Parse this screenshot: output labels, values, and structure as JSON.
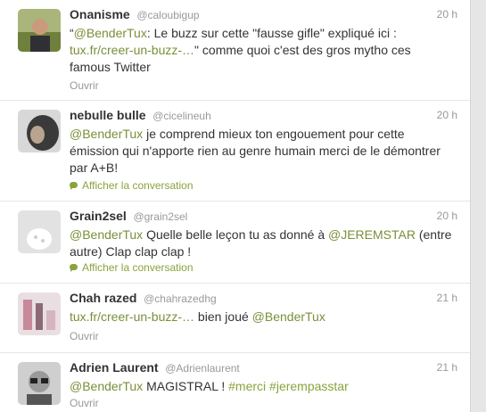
{
  "tweets": [
    {
      "name": "Onanisme",
      "handle": "@caloubigup",
      "time": "20 h",
      "text": [
        {
          "t": "“",
          "c": "plain"
        },
        {
          "t": "@BenderTux",
          "c": "link"
        },
        {
          "t": ": Le buzz sur cette \"fausse gifle\" expliqué ici : ",
          "c": "plain"
        },
        {
          "t": "tux.fr/creer-un-buzz-…",
          "c": "link"
        },
        {
          "t": "\" comme quoi c'est des gros mytho ces famous Twitter",
          "c": "plain"
        }
      ],
      "action": "Ouvrir"
    },
    {
      "name": "nebulle bulle",
      "handle": "@cicelineuh",
      "time": "20 h",
      "text": [
        {
          "t": "@BenderTux",
          "c": "link"
        },
        {
          "t": " je comprend mieux ton engouement pour cette émission qui n'apporte rien au genre humain merci de le démontrer par A+B!",
          "c": "plain"
        }
      ],
      "action": "Afficher la conversation"
    },
    {
      "name": "Grain2sel",
      "handle": "@grain2sel",
      "time": "20 h",
      "text": [
        {
          "t": "@BenderTux",
          "c": "link"
        },
        {
          "t": " Quelle belle leçon tu as donné à ",
          "c": "plain"
        },
        {
          "t": "@JEREMSTAR",
          "c": "link"
        },
        {
          "t": " (entre autre) Clap clap clap !",
          "c": "plain"
        }
      ],
      "action": "Afficher la conversation"
    },
    {
      "name": "Chah razed",
      "handle": "@chahrazedhg",
      "time": "21 h",
      "text": [
        {
          "t": "tux.fr/creer-un-buzz-…",
          "c": "link"
        },
        {
          "t": " bien joué ",
          "c": "plain"
        },
        {
          "t": "@BenderTux",
          "c": "link"
        }
      ],
      "action": "Ouvrir"
    },
    {
      "name": "Adrien Laurent",
      "handle": "@Adrienlaurent",
      "time": "21 h",
      "text": [
        {
          "t": "@BenderTux",
          "c": "link"
        },
        {
          "t": " MAGISTRAL ! ",
          "c": "plain"
        },
        {
          "t": "#merci",
          "c": "hash"
        },
        {
          "t": " ",
          "c": "plain"
        },
        {
          "t": "#jerempasstar",
          "c": "hash"
        }
      ],
      "action": "Ouvrir"
    }
  ],
  "colors": {
    "link": "#7a8f3a",
    "hashtag": "#8aa33c",
    "text": "#333333",
    "meta": "#999999"
  }
}
